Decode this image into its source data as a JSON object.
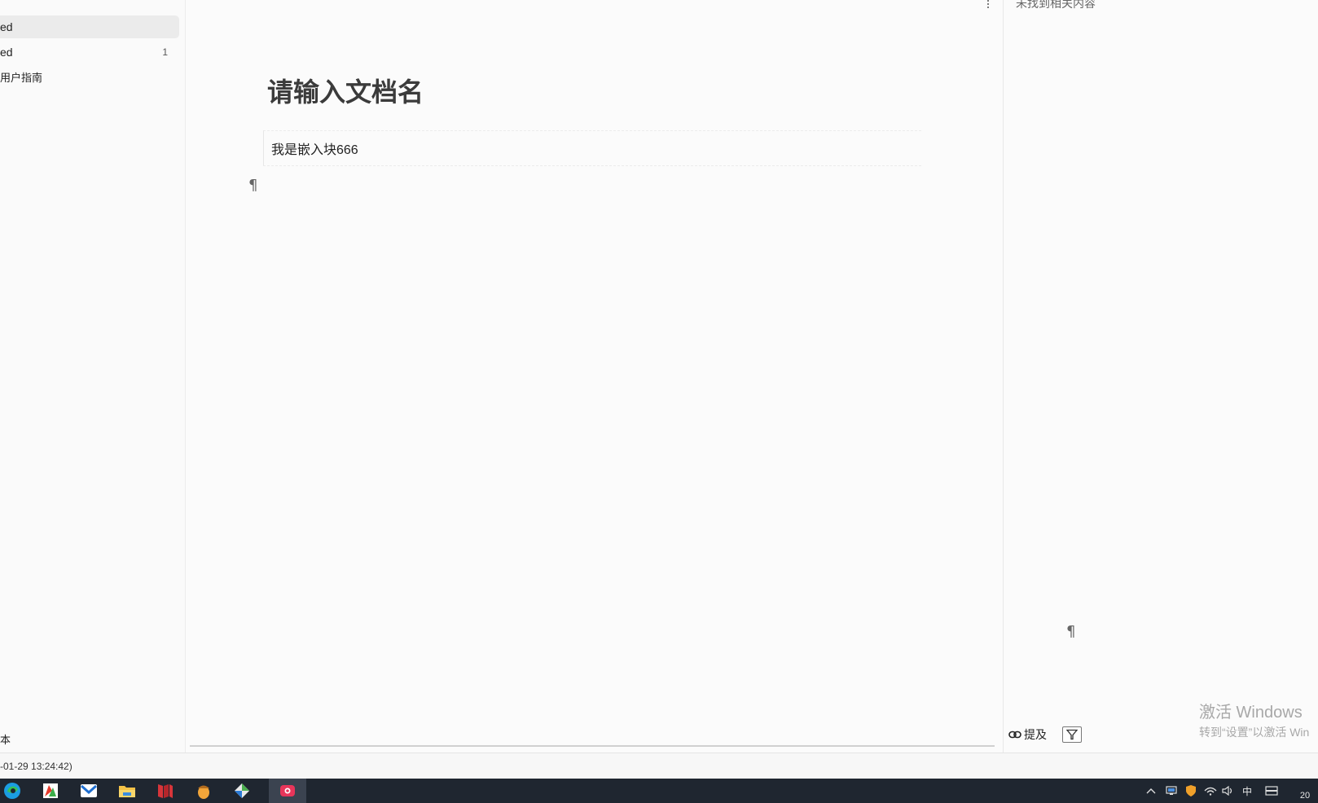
{
  "sidebar": {
    "items": [
      {
        "label": "ed",
        "count": ""
      },
      {
        "label": "ed",
        "count": "1"
      },
      {
        "label": "用户指南",
        "count": ""
      }
    ],
    "bottom_label": "本"
  },
  "editor": {
    "title": "请输入文档名",
    "embed_text": "我是嵌入块666",
    "paragraph_mark": "¶"
  },
  "right_panel": {
    "empty_text": "未找到相关内容",
    "paragraph_mark": "¶",
    "mention_label": "提及"
  },
  "watermark": {
    "line1": "激活 Windows",
    "line2": "转到“设置”以激活 Win"
  },
  "statusbar": {
    "text": "-01-29 13:24:42)"
  },
  "taskbar": {
    "ime_label": "中",
    "clock": "20"
  },
  "colors": {
    "taskbar": "#1f2630",
    "active_item": "#ebebeb",
    "accent_red": "#e8355a"
  }
}
